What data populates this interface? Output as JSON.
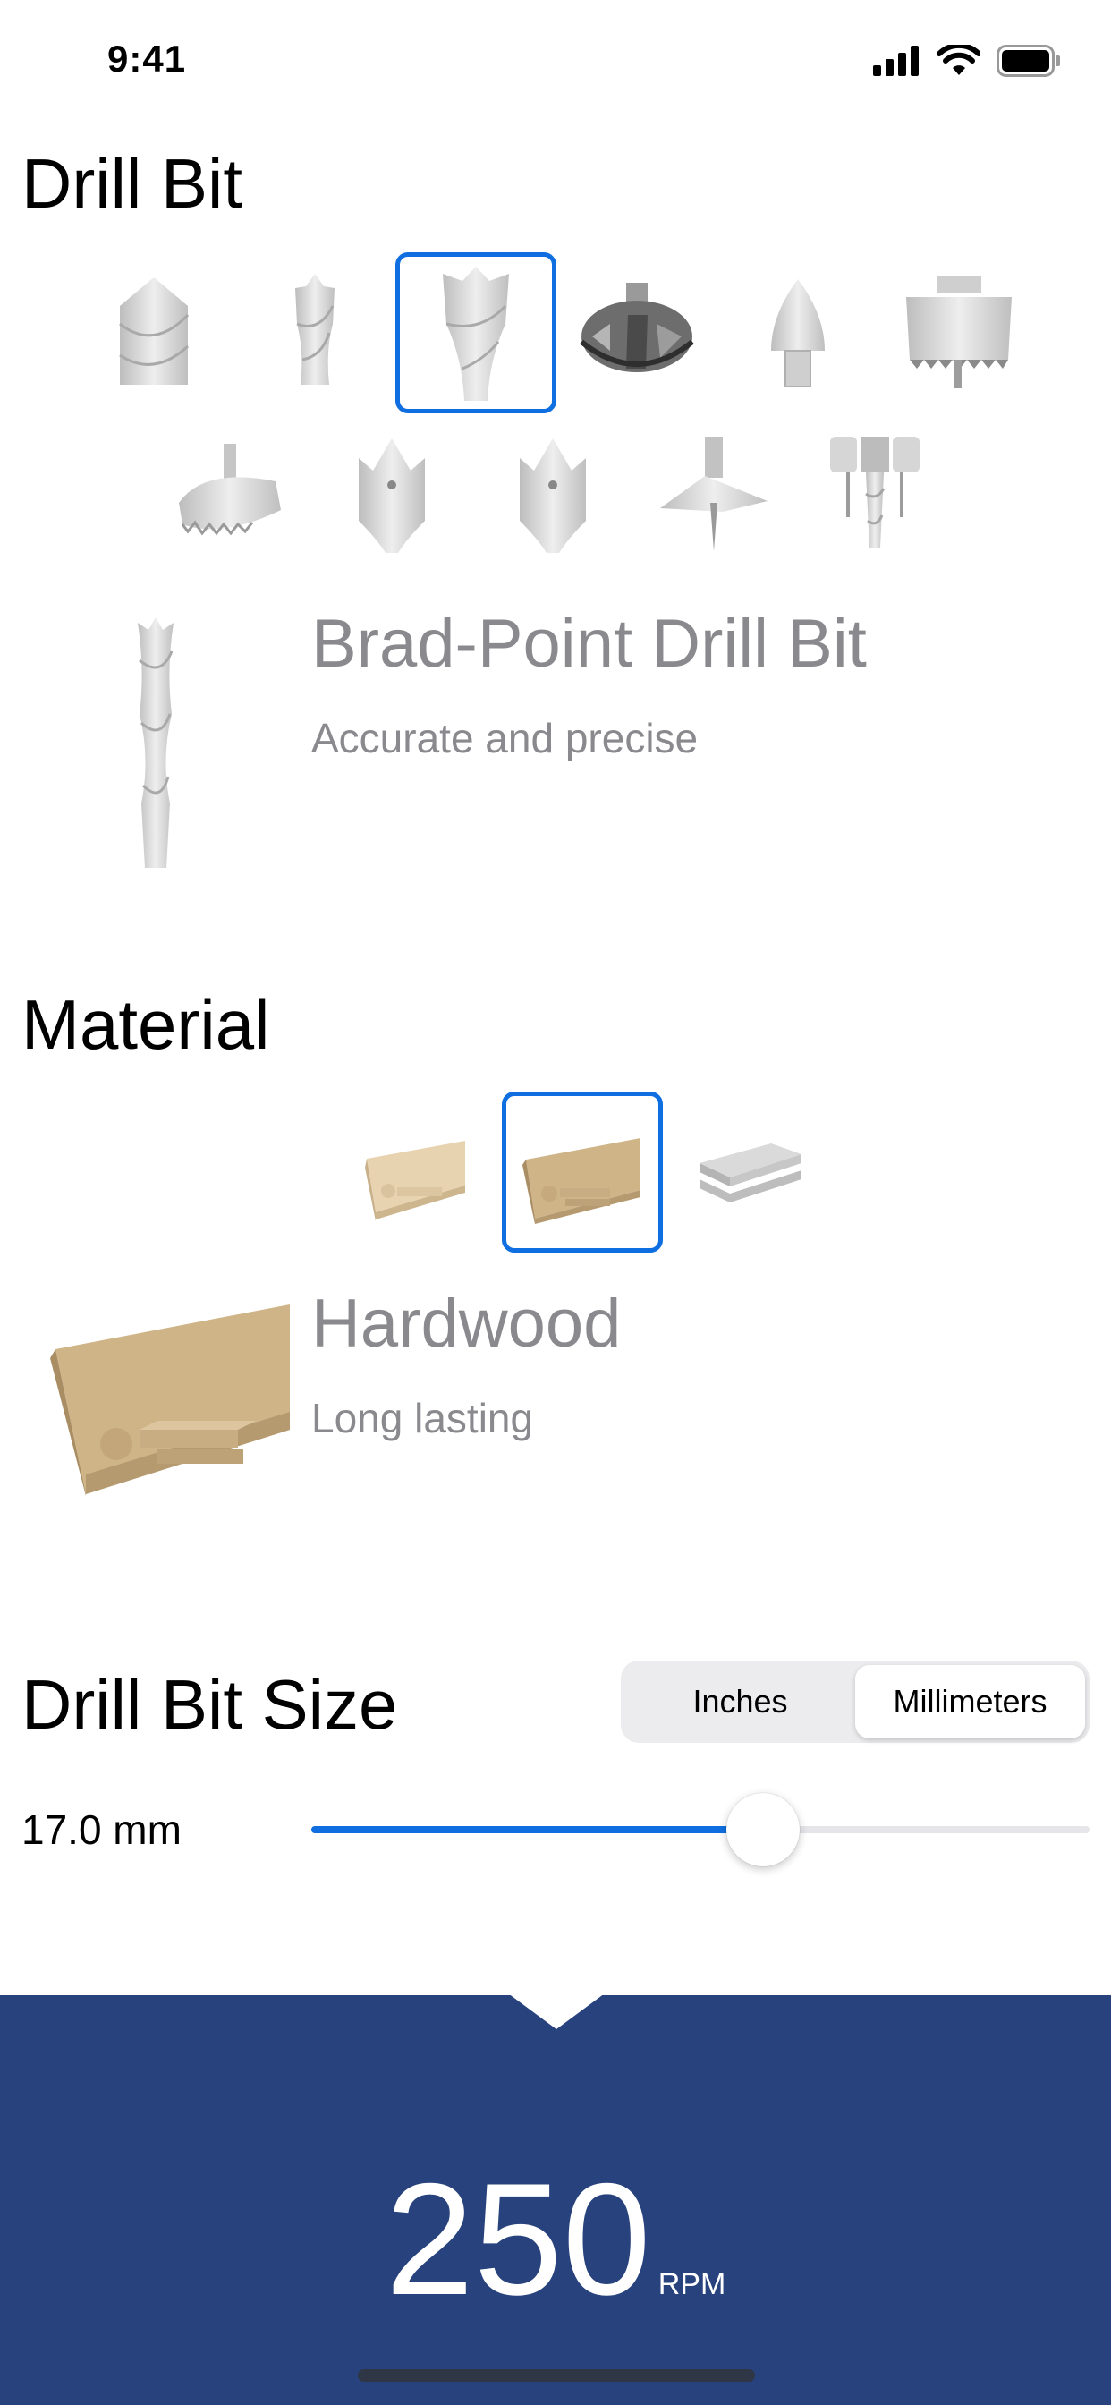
{
  "status_bar": {
    "time": "9:41"
  },
  "drill_bit": {
    "title": "Drill Bit",
    "row1": [
      {
        "icon": "twist-bit-icon"
      },
      {
        "icon": "spiral-bit-icon"
      },
      {
        "icon": "brad-point-bit-icon",
        "selected": true
      },
      {
        "icon": "forstner-bit-icon"
      },
      {
        "icon": "countersink-bit-icon"
      },
      {
        "icon": "hole-saw-icon"
      }
    ],
    "row2": [
      {
        "icon": "circle-cutter-icon"
      },
      {
        "icon": "spade-bit-icon"
      },
      {
        "icon": "paddle-bit-icon"
      },
      {
        "icon": "auger-bit-icon"
      },
      {
        "icon": "plug-cutter-icon"
      }
    ],
    "selected_name": "Brad-Point Drill Bit",
    "selected_desc": "Accurate and precise"
  },
  "material": {
    "title": "Material",
    "options": [
      {
        "icon": "softwood-icon"
      },
      {
        "icon": "hardwood-icon",
        "selected": true
      },
      {
        "icon": "metal-sheet-icon"
      }
    ],
    "selected_name": "Hardwood",
    "selected_desc": "Long lasting"
  },
  "size": {
    "title": "Drill Bit Size",
    "units": {
      "inches": "Inches",
      "millimeters": "Millimeters",
      "selected": "Millimeters"
    },
    "value_label": "17.0 mm",
    "slider_fraction": 0.58
  },
  "result": {
    "value": "250",
    "unit": "RPM"
  },
  "colors": {
    "accent": "#0f6fe0",
    "panel": "#27427c",
    "muted_text": "#8a8a8e"
  }
}
